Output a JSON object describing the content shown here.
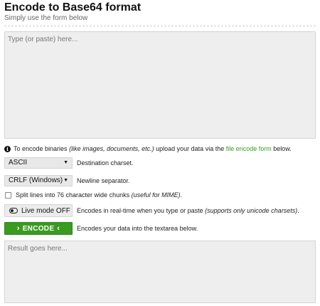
{
  "header": {
    "title": "Encode to Base64 format",
    "subtitle": "Simply use the form below"
  },
  "input": {
    "placeholder": "Type (or paste) here..."
  },
  "info": {
    "icon": "info-icon",
    "text_before": "To encode binaries",
    "text_italic": "(like images, documents, etc.)",
    "text_middle": "upload your data via the",
    "link_text": "file encode form",
    "text_after": "below."
  },
  "charset": {
    "selected": "ASCII",
    "description": "Destination charset."
  },
  "newline": {
    "selected": "CRLF (Windows)",
    "description": "Newline separator."
  },
  "split": {
    "label": "Split lines into 76 character wide chunks",
    "note": "(useful for MIME)",
    "suffix": ".",
    "checked": false
  },
  "live_mode": {
    "button_label": "Live mode OFF",
    "description": "Encodes in real-time when you type or paste",
    "note": "(supports only unicode charsets)",
    "suffix": "."
  },
  "encode": {
    "button_label": "ENCODE",
    "description": "Encodes your data into the textarea below."
  },
  "result": {
    "placeholder": "Result goes here..."
  },
  "colors": {
    "accent_green": "#3a9a22",
    "field_background": "#eeeeee"
  }
}
